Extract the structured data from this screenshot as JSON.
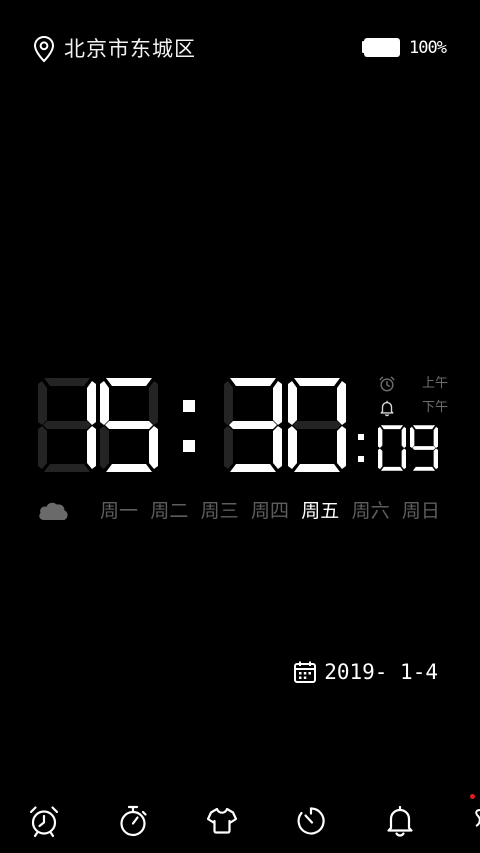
{
  "header": {
    "location": "北京市东城区",
    "location_icon": "map-pin-icon",
    "battery_percent_text": "100%",
    "battery_level": 1.0,
    "battery_icon": "battery-icon"
  },
  "clock": {
    "hours": "15",
    "minutes": "30",
    "seconds": "09",
    "am_label": "上午",
    "pm_label": "下午",
    "alarm_icon": "alarm-clock-icon",
    "bell_icon": "bell-icon",
    "is_pm": true
  },
  "weekdays": {
    "weather_icon": "cloud-icon",
    "days": [
      "周一",
      "周二",
      "周三",
      "周四",
      "周五",
      "周六",
      "周日"
    ],
    "active_index": 4
  },
  "date": {
    "text": "2019- 1-4",
    "icon": "calendar-icon"
  },
  "nav": {
    "items": [
      {
        "icon": "alarm-clock-icon"
      },
      {
        "icon": "stopwatch-icon"
      },
      {
        "icon": "shirt-icon"
      },
      {
        "icon": "timer-icon"
      },
      {
        "icon": "bell-icon"
      }
    ],
    "badge_color": "#e02020"
  },
  "colors": {
    "background": "#000000",
    "foreground": "#ffffff",
    "segment_off": "#242424",
    "inactive_text": "#5e5e5e"
  }
}
